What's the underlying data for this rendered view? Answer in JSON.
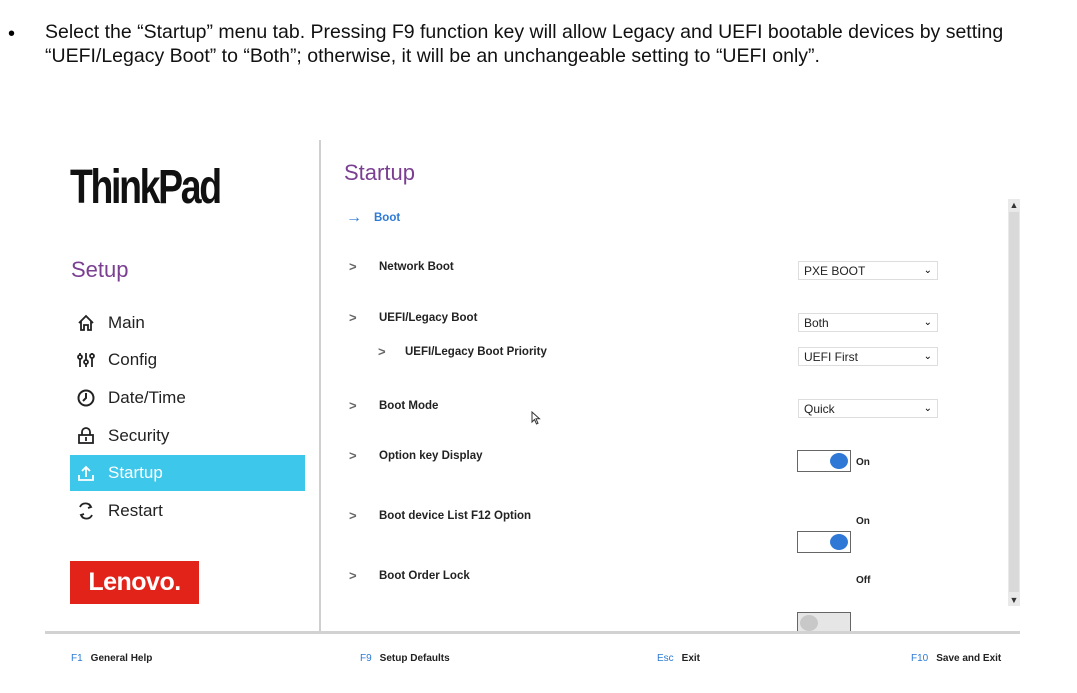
{
  "instruction": {
    "bullet": "•",
    "text": "Select the “Startup” menu tab. Pressing F9 function key will allow Legacy and UEFI bootable devices by setting “UEFI/Legacy Boot” to “Both”; otherwise, it will be an unchangeable setting to “UEFI only”."
  },
  "sidebar": {
    "logo": "ThinkPad",
    "title": "Setup",
    "items": [
      {
        "label": "Main",
        "icon": "home-icon"
      },
      {
        "label": "Config",
        "icon": "sliders-icon"
      },
      {
        "label": "Date/Time",
        "icon": "clock-icon"
      },
      {
        "label": "Security",
        "icon": "lock-icon"
      },
      {
        "label": "Startup",
        "icon": "upload-icon",
        "active": true
      },
      {
        "label": "Restart",
        "icon": "restart-icon"
      }
    ],
    "brand": "Lenovo."
  },
  "content": {
    "title": "Startup",
    "boot_link": "Boot",
    "rows": [
      {
        "label": "Network Boot",
        "control": "select",
        "value": "PXE BOOT"
      },
      {
        "label": "UEFI/Legacy Boot",
        "control": "select",
        "value": "Both"
      },
      {
        "label": "UEFI/Legacy Boot Priority",
        "control": "select",
        "value": "UEFI First",
        "indent": true
      },
      {
        "label": "Boot Mode",
        "control": "select",
        "value": "Quick"
      },
      {
        "label": "Option key Display",
        "control": "toggle",
        "value": "On"
      },
      {
        "label": "Boot device List F12 Option",
        "control": "toggle",
        "value": "On"
      },
      {
        "label": "Boot Order Lock",
        "control": "toggle",
        "value": "Off"
      }
    ]
  },
  "footer": [
    {
      "key": "F1",
      "label": "General Help"
    },
    {
      "key": "F9",
      "label": "Setup Defaults"
    },
    {
      "key": "Esc",
      "label": "Exit"
    },
    {
      "key": "F10",
      "label": "Save and Exit"
    }
  ],
  "colors": {
    "accent": "#3dc7ea",
    "title": "#7b3f92",
    "link": "#2d7bd4",
    "brand": "#e2231a"
  }
}
